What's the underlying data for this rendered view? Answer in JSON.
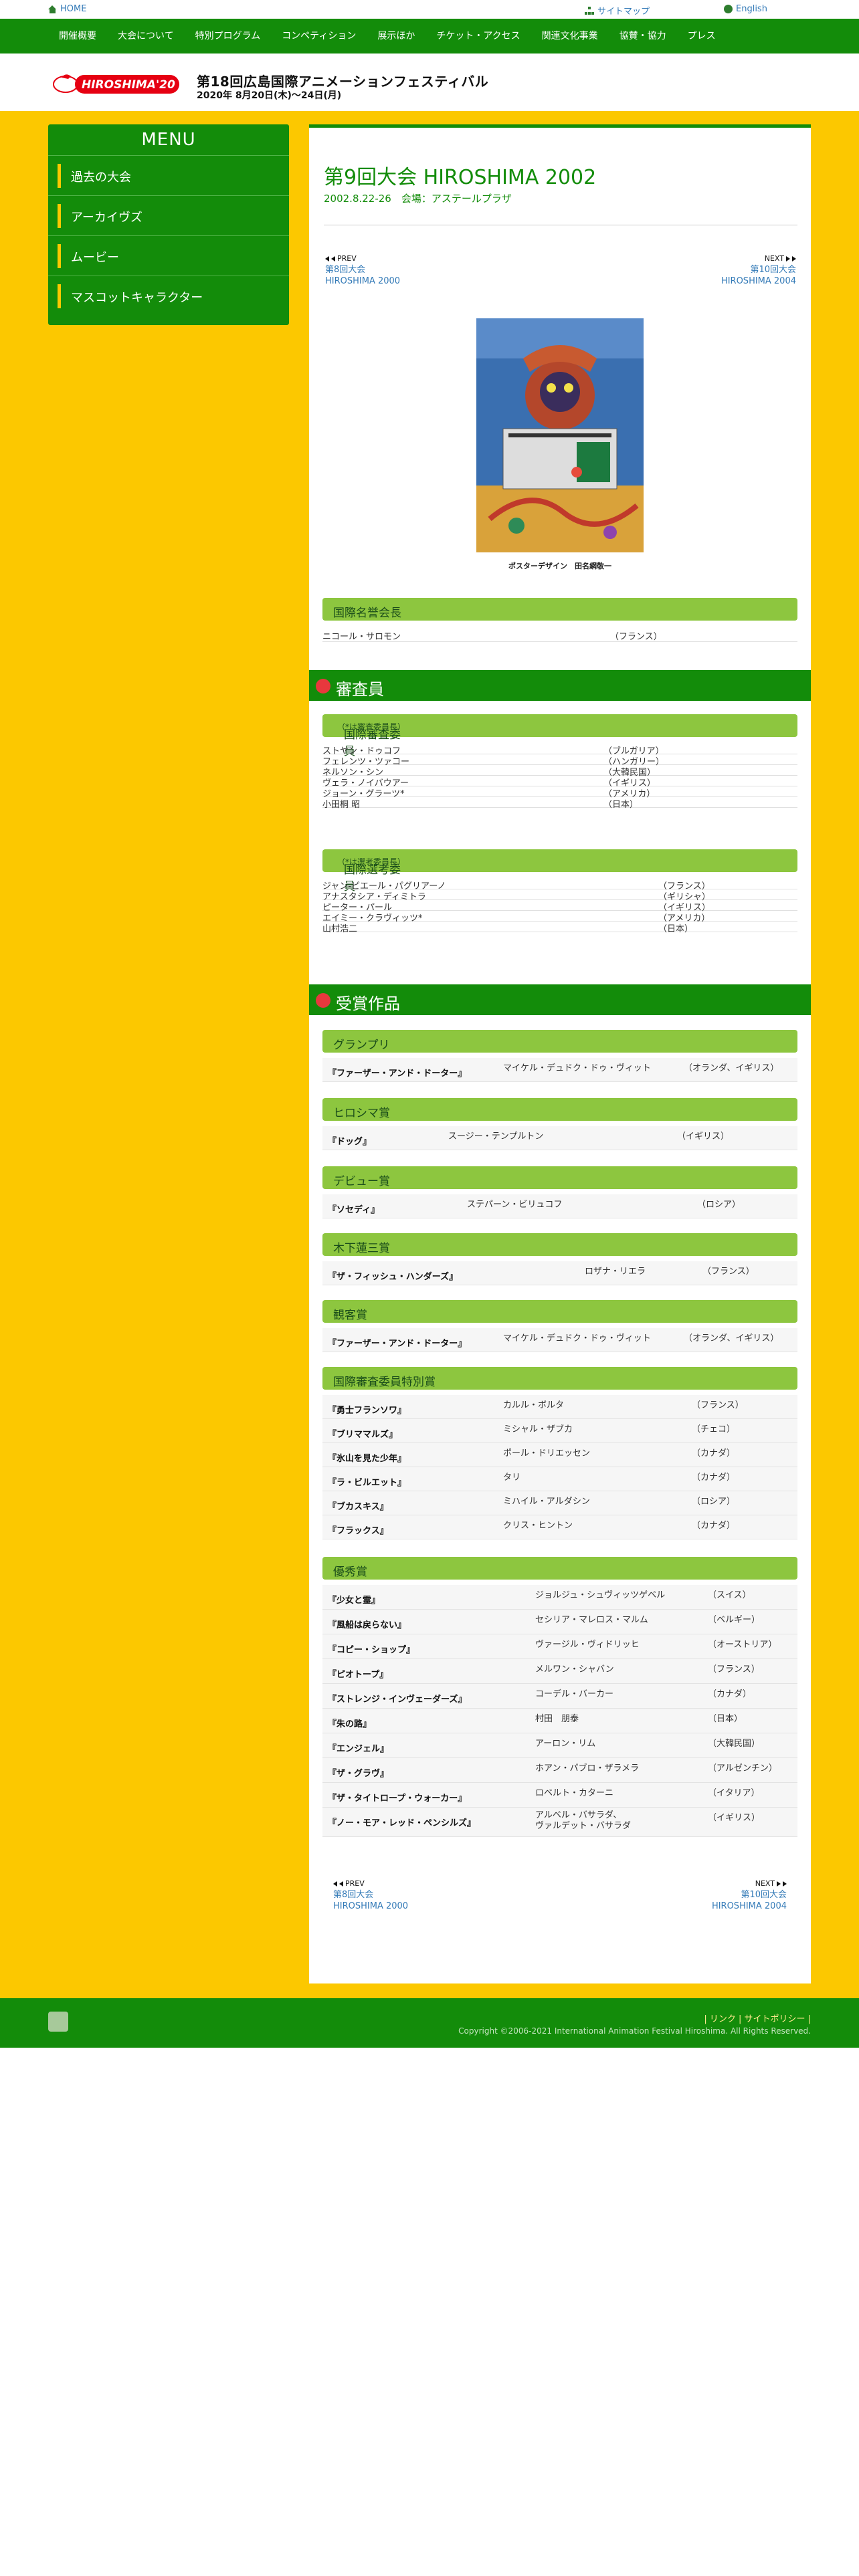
{
  "topbar": {
    "home": "HOME",
    "sitemap": "サイトマップ",
    "english": "English"
  },
  "nav": [
    "開催概要",
    "大会について",
    "特別プログラム",
    "コンペティション",
    "展示ほか",
    "チケット・アクセス",
    "関連文化事業",
    "協賛・協力",
    "プレス"
  ],
  "header": {
    "logo_text": "HIROSHIMA'20",
    "title": "第18回広島国際アニメーションフェスティバル",
    "date": "2020年 8月20日(木)〜24日(月)"
  },
  "menu": {
    "title": "MENU",
    "items": [
      "過去の大会",
      "アーカイヴズ",
      "ムービー",
      "マスコットキャラクター"
    ]
  },
  "page": {
    "title": "第9回大会 HIROSHIMA 2002",
    "subtitle": "2002.8.22-26　会場：アステールプラザ",
    "prev_tag": "PREV",
    "prev_line1": "第8回大会",
    "prev_line2": "HIROSHIMA 2000",
    "next_tag": "NEXT",
    "next_line1": "第10回大会",
    "next_line2": "HIROSHIMA 2004",
    "poster_caption": "ポスターデザイン　田名網敬一"
  },
  "honorary": {
    "heading": "国際名誉会長",
    "rows": [
      {
        "name": "ニコール・サロモン",
        "country": "（フランス）"
      }
    ]
  },
  "jury_section": {
    "heading": "審査員"
  },
  "jury": {
    "heading": "国際審査委員",
    "note": "（*は審査委員長）",
    "rows": [
      {
        "name": "ストヤン・ドゥコフ",
        "country": "（ブルガリア）"
      },
      {
        "name": "フェレンツ・ツァコー",
        "country": "（ハンガリー）"
      },
      {
        "name": "ネルソン・シン",
        "country": "（大韓民国）"
      },
      {
        "name": "ヴェラ・ノイバウアー",
        "country": "（イギリス）"
      },
      {
        "name": "ジョーン・グラーツ*",
        "country": "（アメリカ）"
      },
      {
        "name": "小田桐 昭",
        "country": "（日本）"
      }
    ]
  },
  "selection": {
    "heading": "国際選考委員",
    "note": "（*は選考委員長）",
    "rows": [
      {
        "name": "ジャン-ピエール・パグリアーノ",
        "country": "（フランス）"
      },
      {
        "name": "アナスタシア・ディミトラ",
        "country": "（ギリシャ）"
      },
      {
        "name": "ピーター・パール",
        "country": "（イギリス）"
      },
      {
        "name": "エイミー・クラヴィッツ*",
        "country": "（アメリカ）"
      },
      {
        "name": "山村浩二",
        "country": "（日本）"
      }
    ]
  },
  "awards_section": {
    "heading": "受賞作品"
  },
  "grandprix": {
    "heading": "グランプリ",
    "rows": [
      {
        "title": "『ファーザー・アンド・ドーター』",
        "director": "マイケル・デュドク・ドゥ・ヴィット",
        "country": "（オランダ、イギリス）"
      }
    ]
  },
  "hiroshima": {
    "heading": "ヒロシマ賞",
    "rows": [
      {
        "title": "『ドッグ』",
        "director": "スージー・テンプルトン",
        "country": "（イギリス）"
      }
    ]
  },
  "debut": {
    "heading": "デビュー賞",
    "rows": [
      {
        "title": "『ソセディ』",
        "director": "ステパーン・ビリュコフ",
        "country": "（ロシア）"
      }
    ]
  },
  "kinoshita": {
    "heading": "木下蓮三賞",
    "rows": [
      {
        "title": "『ザ・フィッシュ・ハンダーズ』",
        "director": "ロザナ・リエラ",
        "country": "（フランス）"
      }
    ]
  },
  "audience": {
    "heading": "観客賞",
    "rows": [
      {
        "title": "『ファーザー・アンド・ドーター』",
        "director": "マイケル・デュドク・ドゥ・ヴィット",
        "country": "（オランダ、イギリス）"
      }
    ]
  },
  "special": {
    "heading": "国際審査委員特別賞",
    "rows": [
      {
        "title": "『勇士フランソワ』",
        "director": "カルル・ボルタ",
        "country": "（フランス）"
      },
      {
        "title": "『ブリママルズ』",
        "director": "ミシャル・ザブカ",
        "country": "（チェコ）"
      },
      {
        "title": "『氷山を見た少年』",
        "director": "ポール・ドリエッセン",
        "country": "（カナダ）"
      },
      {
        "title": "『ラ・ビルエット』",
        "director": "タリ",
        "country": "（カナダ）"
      },
      {
        "title": "『ブカスキス』",
        "director": "ミハイル・アルダシン",
        "country": "（ロシア）"
      },
      {
        "title": "『フラックス』",
        "director": "クリス・ヒントン",
        "country": "（カナダ）"
      }
    ]
  },
  "merit": {
    "heading": "優秀賞",
    "rows": [
      {
        "title": "『少女と霊』",
        "director": "ジョルジュ・シュヴィッツゲベル",
        "country": "（スイス）"
      },
      {
        "title": "『風船は戻らない』",
        "director": "セシリア・マレロス・マルム",
        "country": "（ベルギー）"
      },
      {
        "title": "『コピー・ショップ』",
        "director": "ヴァージル・ヴィドリッヒ",
        "country": "（オーストリア）"
      },
      {
        "title": "『ピオトープ』",
        "director": "メルワン・シャバン",
        "country": "（フランス）"
      },
      {
        "title": "『ストレンジ・インヴェーダーズ』",
        "director": "コーデル・バーカー",
        "country": "（カナダ）"
      },
      {
        "title": "『朱の路』",
        "director": "村田　朋泰",
        "country": "（日本）"
      },
      {
        "title": "『エンジェル』",
        "director": "アーロン・リム",
        "country": "（大韓民国）"
      },
      {
        "title": "『ザ・グラヴ』",
        "director": "ホアン・パブロ・ザラメラ",
        "country": "（アルゼンチン）"
      },
      {
        "title": "『ザ・タイトロープ・ウォーカー』",
        "director": "ロベルト・カターニ",
        "country": "（イタリア）"
      },
      {
        "title": "『ノー・モア・レッド・ペンシルズ』",
        "director": "アルベル・バサラダ、\nヴァルデット・バサラダ",
        "country": "（イギリス）"
      }
    ]
  },
  "footer": {
    "links": "| リンク | サイトポリシー |",
    "copyright": "Copyright ©2006-2021 International Animation Festival Hiroshima. All Rights Reserved."
  },
  "colors": {
    "green": "#138c0a",
    "light_green": "#8dc63f",
    "yellow": "#fcc800",
    "link": "#337ab7",
    "badge": "#e8383d"
  }
}
